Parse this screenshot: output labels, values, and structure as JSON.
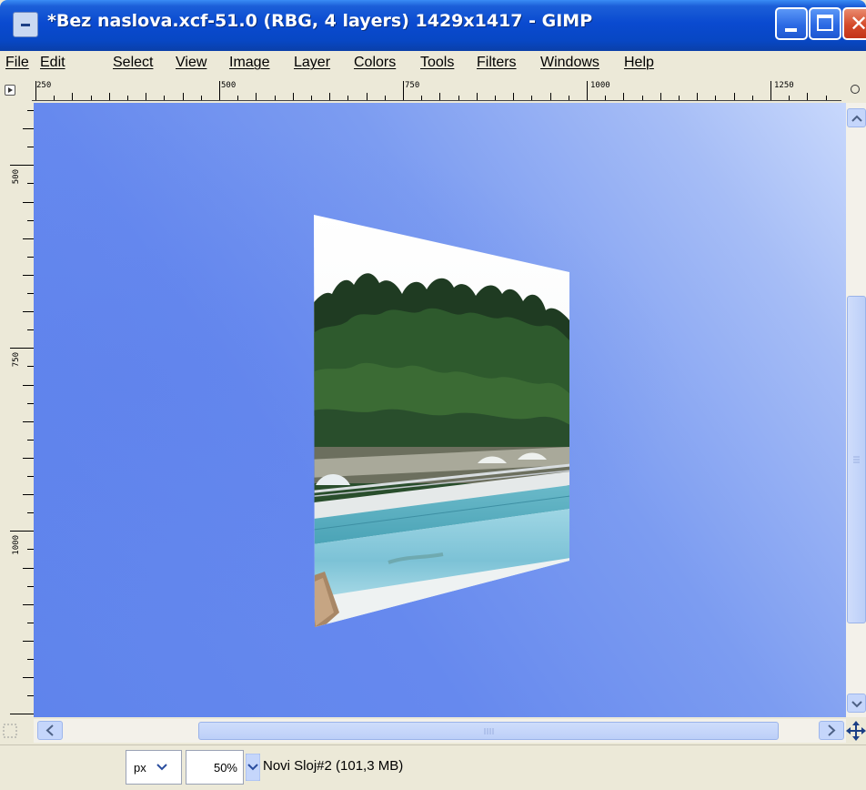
{
  "window": {
    "title": "*Bez naslova.xcf-51.0 (RBG, 4 layers) 1429x1417 - GIMP",
    "controls": {
      "close_glyph": "✕"
    }
  },
  "menubar": {
    "items": [
      {
        "label": "File",
        "name": "menu-file"
      },
      {
        "label": "Edit",
        "name": "menu-edit"
      },
      {
        "label": "Select",
        "name": "menu-select"
      },
      {
        "label": "View",
        "name": "menu-view"
      },
      {
        "label": "Image",
        "name": "menu-image"
      },
      {
        "label": "Layer",
        "name": "menu-layer"
      },
      {
        "label": "Colors",
        "name": "menu-colors"
      },
      {
        "label": "Tools",
        "name": "menu-tools"
      },
      {
        "label": "Filters",
        "name": "menu-filters"
      },
      {
        "label": "Windows",
        "name": "menu-windows"
      },
      {
        "label": "Help",
        "name": "menu-help"
      }
    ]
  },
  "rulers": {
    "horizontal": [
      "250",
      "500",
      "750",
      "1000",
      "1250"
    ],
    "vertical": [
      "500",
      "750",
      "1000"
    ]
  },
  "canvas": {
    "background": "#6f8fef",
    "layer_description": "Perspective-transformed photo of pine trees above a swimming pool"
  },
  "statusbar": {
    "unit": "px",
    "zoom": "50%",
    "layer_info": "Novi Sloj#2 (101,3 MB)"
  },
  "icons": [
    "gimp-app-icon",
    "minimize-icon",
    "maximize-icon",
    "close-icon",
    "ruler-menu-icon",
    "zoom-icon",
    "scroll-up-icon",
    "scroll-down-icon",
    "scroll-left-icon",
    "scroll-right-icon",
    "navigate-icon",
    "quickmask-icon"
  ]
}
